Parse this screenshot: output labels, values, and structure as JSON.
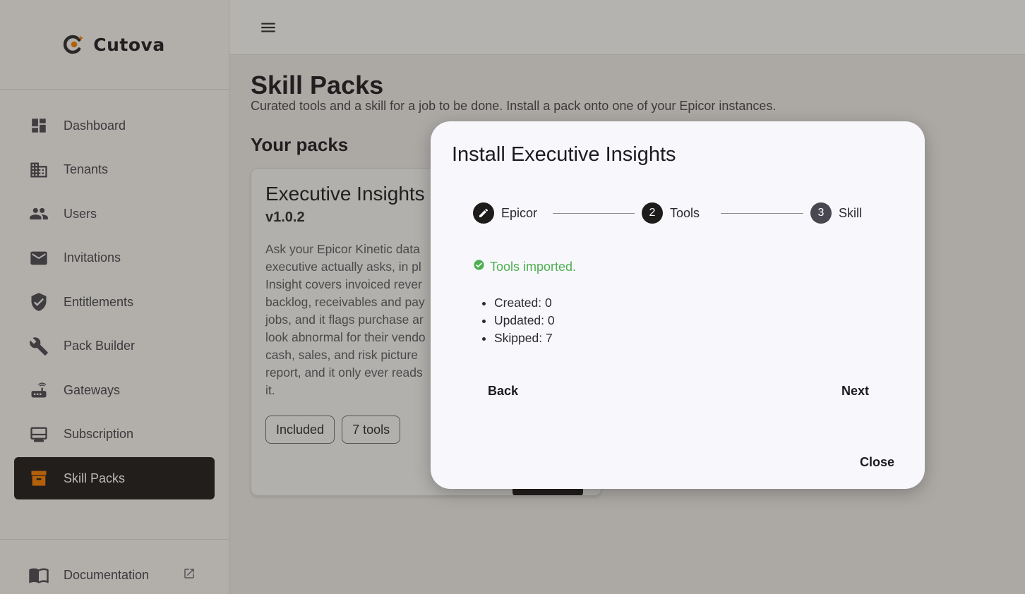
{
  "brand": {
    "name": "Cutova"
  },
  "sidebar": {
    "items": [
      {
        "label": "Dashboard",
        "icon": "dashboard-icon"
      },
      {
        "label": "Tenants",
        "icon": "building-icon"
      },
      {
        "label": "Users",
        "icon": "people-icon"
      },
      {
        "label": "Invitations",
        "icon": "mail-icon"
      },
      {
        "label": "Entitlements",
        "icon": "shield-check-icon"
      },
      {
        "label": "Pack Builder",
        "icon": "wrench-icon"
      },
      {
        "label": "Gateways",
        "icon": "router-icon"
      },
      {
        "label": "Subscription",
        "icon": "monitor-icon"
      },
      {
        "label": "Skill Packs",
        "icon": "archive-icon",
        "active": true
      }
    ],
    "documentation": {
      "label": "Documentation",
      "icon": "book-icon"
    }
  },
  "page": {
    "title": "Skill Packs",
    "subtitle": "Curated tools and a skill for a job to be done. Install a pack onto one of your Epicor instances.",
    "section_title": "Your packs"
  },
  "pack_card": {
    "title": "Executive Insights",
    "version": "v1.0.2",
    "description": "Ask your Epicor Kinetic data executive actually asks, in pl Insight covers invoiced rever backlog, receivables and pay jobs, and it flags purchase a look abnormal for their vendo cash, sales, and risk picture report, and it only ever reads it.",
    "description_lines": [
      "Ask your Epicor Kinetic data",
      "executive actually asks, in pl",
      "Insight covers invoiced rever",
      "backlog, receivables and pay",
      "jobs, and it flags purchase ar",
      "look abnormal for their vendo",
      "cash, sales, and risk picture",
      "report, and it only ever reads",
      "it."
    ],
    "chips": [
      "Included",
      "7 tools"
    ]
  },
  "dialog": {
    "title": "Install Executive Insights",
    "steps": [
      {
        "label": "Epicor",
        "marker": "edit"
      },
      {
        "label": "Tools",
        "marker": "2"
      },
      {
        "label": "Skill",
        "marker": "3"
      }
    ],
    "status": "Tools imported.",
    "stats": [
      "Created: 0",
      "Updated: 0",
      "Skipped: 7"
    ],
    "back_label": "Back",
    "next_label": "Next",
    "close_label": "Close"
  },
  "colors": {
    "accent": "#f57c00",
    "active_nav_bg": "#1e1b1b",
    "success": "#4caf50",
    "step_inactive": "#49474f"
  }
}
